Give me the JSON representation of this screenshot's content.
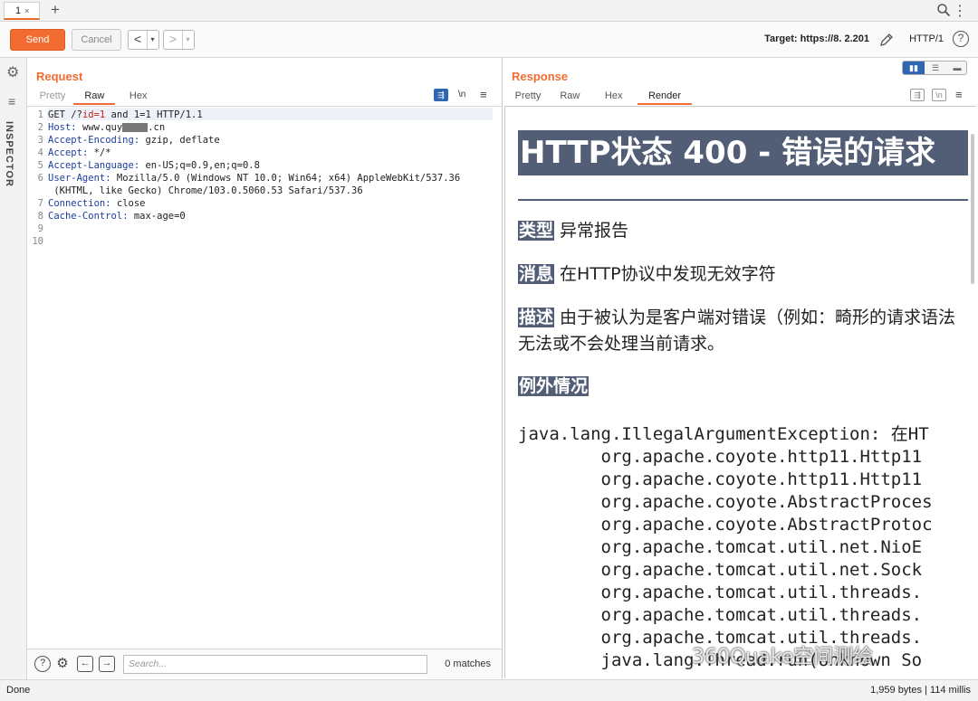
{
  "tabs": [
    {
      "label": "1",
      "close": "×"
    }
  ],
  "tab_add": "+",
  "toolbar": {
    "send": "Send",
    "cancel": "Cancel",
    "back": "<",
    "forward": ">",
    "dropdown": "▾",
    "target": "Target: https://8.     2.201",
    "http_version": "HTTP/1",
    "help": "?"
  },
  "inspector_label": "INSPECTOR",
  "request": {
    "title": "Request",
    "tabs": [
      "Pretty",
      "Raw",
      "Hex"
    ],
    "active_tab": "Raw",
    "wrap_icon": "⇶",
    "newline_toggle": "\\n",
    "menu": "≡",
    "lines": [
      {
        "n": "1",
        "name": "",
        "value": "GET /?",
        "param": "id=1",
        "rest": " and 1=1 HTTP/1.1"
      },
      {
        "n": "2",
        "name": "Host",
        "value": " www.quy",
        "redacted": true,
        "rest": ".cn"
      },
      {
        "n": "3",
        "name": "Accept-Encoding",
        "value": " gzip, deflate"
      },
      {
        "n": "4",
        "name": "Accept",
        "value": " */*"
      },
      {
        "n": "5",
        "name": "Accept-Language",
        "value": " en-US;q=0.9,en;q=0.8"
      },
      {
        "n": "6",
        "name": "User-Agent",
        "value": " Mozilla/5.0 (Windows NT 10.0; Win64; x64) AppleWebKit/537.36"
      },
      {
        "n": "",
        "name": "",
        "value": " (KHTML, like Gecko) Chrome/103.0.5060.53 Safari/537.36"
      },
      {
        "n": "7",
        "name": "Connection",
        "value": " close"
      },
      {
        "n": "8",
        "name": "Cache-Control",
        "value": " max-age=0"
      },
      {
        "n": "9",
        "name": "",
        "value": ""
      },
      {
        "n": "10",
        "name": "",
        "value": ""
      }
    ],
    "search_placeholder": "Search...",
    "matches": "0 matches"
  },
  "response": {
    "title": "Response",
    "tabs": [
      "Pretty",
      "Raw",
      "Hex",
      "Render"
    ],
    "active_tab": "Render",
    "render": {
      "heading": "HTTP状态 400 - 错误的请求",
      "type_label": "类型",
      "type_value": "异常报告",
      "message_label": "消息",
      "message_value": "在HTTP协议中发现无效字符",
      "desc_label": "描述",
      "desc_value": "由于被认为是客户端对错误（例如：畸形的请求语法",
      "desc_value2": "无法或不会处理当前请求。",
      "exception_label": "例外情况",
      "trace": [
        "java.lang.IllegalArgumentException: 在HT",
        "        org.apache.coyote.http11.Http11",
        "        org.apache.coyote.http11.Http11",
        "        org.apache.coyote.AbstractProces",
        "        org.apache.coyote.AbstractProtoc",
        "        org.apache.tomcat.util.net.NioE",
        "        org.apache.tomcat.util.net.Sock",
        "        org.apache.tomcat.util.threads.",
        "        org.apache.tomcat.util.threads.",
        "        org.apache.tomcat.util.threads.",
        "        java.lang.Thread.run(Unknown So"
      ],
      "watermark": "360Quake空间测绘"
    }
  },
  "status": {
    "left": "Done",
    "right": "1,959 bytes | 114 millis"
  },
  "colors": {
    "accent": "#f26b31",
    "render_label_bg": "#525d76",
    "header_name": "#1c3e9b",
    "param": "#c02020"
  }
}
